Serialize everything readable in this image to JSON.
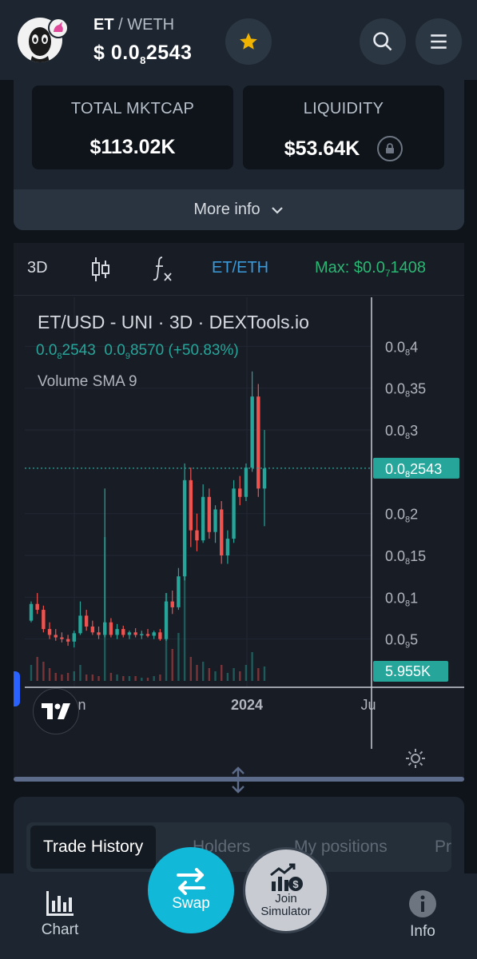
{
  "header": {
    "base_symbol": "ET",
    "separator": "/",
    "quote_symbol": "WETH",
    "price_prefix": "$ 0.0",
    "price_sub": "8",
    "price_rest": "2543",
    "star_color": "#f0b400",
    "icons": [
      "token-avatar-icon",
      "star-icon",
      "search-icon",
      "menu-icon"
    ]
  },
  "stats": {
    "mktcap_label": "TOTAL MKTCAP",
    "mktcap_value": "$113.02K",
    "liquidity_label": "LIQUIDITY",
    "liquidity_value": "$53.64K",
    "more_info": "More info"
  },
  "toolbar": {
    "interval": "3D",
    "pair": "ET/ETH",
    "max_label": "Max: $0.0",
    "max_sub": "7",
    "max_rest": "1408",
    "pair_color": "#3b9ad9",
    "max_color": "#2bb673"
  },
  "chart_legend": {
    "title": "ET/USD - UNI · 3D · DEXTools.io",
    "value_a_prefix": "0.0",
    "value_a_sub": "8",
    "value_a_rest": "2543",
    "value_b_prefix": "0.0",
    "value_b_sub": "9",
    "value_b_rest": "8570 (+50.83%)",
    "volume_label": "Volume SMA 9"
  },
  "chart_data": {
    "type": "candlestick",
    "price_axis": [
      {
        "prefix": "0.0",
        "sub": "8",
        "rest": "4",
        "value": 4.0
      },
      {
        "prefix": "0.0",
        "sub": "8",
        "rest": "35",
        "value": 3.5
      },
      {
        "prefix": "0.0",
        "sub": "8",
        "rest": "3",
        "value": 3.0
      },
      {
        "prefix": "0.0",
        "sub": "8",
        "rest": "2",
        "value": 2.0
      },
      {
        "prefix": "0.0",
        "sub": "8",
        "rest": "15",
        "value": 1.5
      },
      {
        "prefix": "0.0",
        "sub": "8",
        "rest": "1",
        "value": 1.0
      },
      {
        "prefix": "0.0",
        "sub": "9",
        "rest": "5",
        "value": 0.5
      }
    ],
    "current_price": {
      "prefix": "0.0",
      "sub": "8",
      "rest": "2543",
      "value": 2.543
    },
    "volume_tag": "5.955K",
    "time_axis": [
      "Jun",
      "2024",
      "Ju"
    ],
    "ylim": [
      0.0,
      4.3
    ],
    "up_color": "#26a69a",
    "down_color": "#ef5350",
    "candles": [
      [
        0.72,
        0.95,
        0.7,
        0.92
      ],
      [
        0.92,
        1.05,
        0.8,
        0.85
      ],
      [
        0.85,
        0.9,
        0.58,
        0.62
      ],
      [
        0.62,
        0.7,
        0.5,
        0.55
      ],
      [
        0.55,
        0.62,
        0.48,
        0.52
      ],
      [
        0.52,
        0.58,
        0.46,
        0.5
      ],
      [
        0.5,
        0.55,
        0.42,
        0.47
      ],
      [
        0.47,
        0.6,
        0.4,
        0.57
      ],
      [
        0.57,
        0.95,
        0.55,
        0.78
      ],
      [
        0.78,
        0.85,
        0.6,
        0.65
      ],
      [
        0.65,
        0.72,
        0.55,
        0.58
      ],
      [
        0.58,
        0.65,
        0.5,
        0.55
      ],
      [
        0.55,
        2.3,
        0.52,
        0.7
      ],
      [
        0.7,
        0.75,
        0.52,
        0.55
      ],
      [
        0.55,
        0.68,
        0.5,
        0.62
      ],
      [
        0.62,
        0.66,
        0.52,
        0.55
      ],
      [
        0.55,
        0.6,
        0.5,
        0.58
      ],
      [
        0.58,
        0.63,
        0.52,
        0.55
      ],
      [
        0.55,
        0.6,
        0.5,
        0.56
      ],
      [
        0.56,
        0.62,
        0.52,
        0.54
      ],
      [
        0.54,
        0.6,
        0.5,
        0.58
      ],
      [
        0.58,
        0.62,
        0.48,
        0.5
      ],
      [
        0.5,
        1.05,
        0.48,
        0.95
      ],
      [
        0.95,
        1.08,
        0.8,
        0.88
      ],
      [
        0.88,
        1.35,
        0.85,
        1.25
      ],
      [
        1.25,
        2.6,
        1.2,
        2.4
      ],
      [
        2.4,
        2.55,
        1.6,
        1.8
      ],
      [
        1.8,
        2.0,
        1.55,
        1.68
      ],
      [
        1.68,
        2.35,
        1.65,
        2.2
      ],
      [
        2.2,
        2.3,
        1.7,
        1.78
      ],
      [
        1.78,
        2.1,
        1.65,
        2.05
      ],
      [
        2.05,
        2.15,
        1.4,
        1.5
      ],
      [
        1.5,
        1.8,
        1.4,
        1.7
      ],
      [
        1.7,
        2.4,
        1.65,
        2.3
      ],
      [
        2.3,
        2.45,
        2.1,
        2.2
      ],
      [
        2.2,
        2.6,
        2.15,
        2.55
      ],
      [
        2.55,
        3.7,
        2.5,
        3.4
      ],
      [
        3.4,
        3.55,
        2.2,
        2.3
      ],
      [
        2.3,
        3.0,
        1.85,
        2.54
      ]
    ],
    "volumes": [
      0.1,
      0.15,
      0.12,
      0.08,
      0.05,
      0.04,
      0.05,
      0.06,
      0.1,
      0.04,
      0.04,
      0.03,
      0.9,
      0.05,
      0.04,
      0.03,
      0.03,
      0.03,
      0.02,
      0.02,
      0.03,
      0.04,
      0.55,
      0.2,
      0.3,
      1.0,
      0.15,
      0.1,
      0.12,
      0.08,
      0.06,
      0.1,
      0.05,
      0.08,
      0.06,
      0.1,
      0.18,
      0.08,
      0.09
    ]
  },
  "tabs": {
    "trade_history": "Trade History",
    "holders": "Holders",
    "my_positions": "My positions",
    "pr": "Pr"
  },
  "bottom_nav": {
    "chart": "Chart",
    "swap": "Swap",
    "join_line1": "Join",
    "join_line2": "Simulator",
    "info": "Info"
  }
}
